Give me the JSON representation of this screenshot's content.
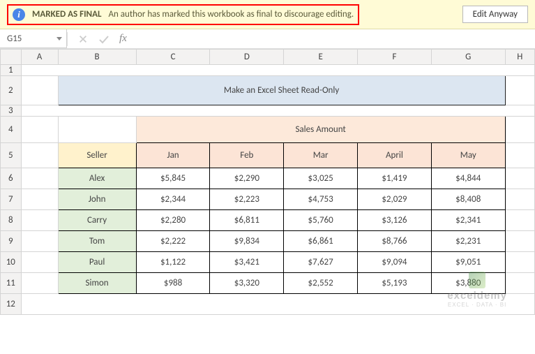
{
  "messageBar": {
    "title": "MARKED AS FINAL",
    "description": "An author has marked this workbook as final to discourage editing.",
    "button": "Edit Anyway"
  },
  "nameBox": {
    "value": "G15"
  },
  "formulaBar": {
    "fxLabel": "fx"
  },
  "columns": [
    "A",
    "B",
    "C",
    "D",
    "E",
    "F",
    "G",
    "H"
  ],
  "rowNumbers": [
    "1",
    "2",
    "3",
    "4",
    "5",
    "6",
    "7",
    "8",
    "9",
    "10",
    "11",
    "12"
  ],
  "sheet": {
    "title": "Make an Excel Sheet Read-Only",
    "salesHeader": "Sales Amount",
    "sellerHeader": "Seller",
    "months": [
      "Jan",
      "Feb",
      "Mar",
      "April",
      "May"
    ],
    "rows": [
      {
        "seller": "Alex",
        "vals": [
          "$5,845",
          "$2,290",
          "$3,025",
          "$1,419",
          "$4,844"
        ]
      },
      {
        "seller": "John",
        "vals": [
          "$2,344",
          "$2,223",
          "$4,753",
          "$2,029",
          "$8,408"
        ]
      },
      {
        "seller": "Carry",
        "vals": [
          "$2,280",
          "$6,811",
          "$5,760",
          "$3,126",
          "$2,341"
        ]
      },
      {
        "seller": "Tom",
        "vals": [
          "$2,222",
          "$9,834",
          "$6,861",
          "$8,766",
          "$2,231"
        ]
      },
      {
        "seller": "Paul",
        "vals": [
          "$1,122",
          "$3,421",
          "$7,627",
          "$9,094",
          "$9,051"
        ]
      },
      {
        "seller": "Simon",
        "vals": [
          "$988",
          "$3,320",
          "$2,552",
          "$5,193",
          "$3,880"
        ]
      }
    ]
  },
  "watermark": {
    "name": "exceldemy",
    "tag": "EXCEL · DATA · BI"
  },
  "chart_data": {
    "type": "table",
    "title": "Sales Amount",
    "columns": [
      "Seller",
      "Jan",
      "Feb",
      "Mar",
      "April",
      "May"
    ],
    "rows": [
      [
        "Alex",
        5845,
        2290,
        3025,
        1419,
        4844
      ],
      [
        "John",
        2344,
        2223,
        4753,
        2029,
        8408
      ],
      [
        "Carry",
        2280,
        6811,
        5760,
        3126,
        2341
      ],
      [
        "Tom",
        2222,
        9834,
        6861,
        8766,
        2231
      ],
      [
        "Paul",
        1122,
        3421,
        7627,
        9094,
        9051
      ],
      [
        "Simon",
        988,
        3320,
        2552,
        5193,
        3880
      ]
    ]
  }
}
